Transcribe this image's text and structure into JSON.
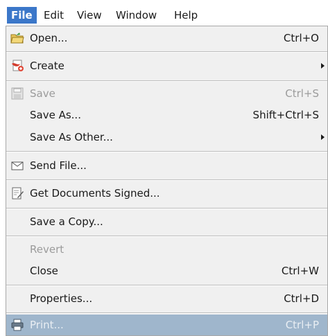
{
  "menubar": {
    "items": [
      {
        "label": "File"
      },
      {
        "label": "Edit"
      },
      {
        "label": "View"
      },
      {
        "label": "Window"
      },
      {
        "label": "Help"
      }
    ]
  },
  "menu": {
    "items": [
      {
        "label": "Open...",
        "shortcut": "Ctrl+O",
        "icon": "open-folder-icon"
      },
      {
        "label": "Create",
        "shortcut": "",
        "icon": "create-pdf-icon",
        "submenu": true
      },
      {
        "label": "Save",
        "shortcut": "Ctrl+S",
        "icon": "save-disk-icon",
        "disabled": true
      },
      {
        "label": "Save As...",
        "shortcut": "Shift+Ctrl+S"
      },
      {
        "label": "Save As Other...",
        "shortcut": "",
        "submenu": true
      },
      {
        "label": "Send File...",
        "shortcut": "",
        "icon": "envelope-icon"
      },
      {
        "label": "Get Documents Signed...",
        "shortcut": "",
        "icon": "sign-document-icon"
      },
      {
        "label": "Save a Copy...",
        "shortcut": ""
      },
      {
        "label": "Revert",
        "shortcut": "",
        "disabled": true
      },
      {
        "label": "Close",
        "shortcut": "Ctrl+W"
      },
      {
        "label": "Properties...",
        "shortcut": "Ctrl+D"
      },
      {
        "label": "Print...",
        "shortcut": "Ctrl+P",
        "icon": "printer-icon",
        "highlighted": true
      }
    ]
  },
  "colors": {
    "active_menu": "#3b77c9",
    "highlight": "#9fb6cc",
    "menu_background": "#f0f0f0",
    "disabled_text": "#9b9b9b"
  }
}
